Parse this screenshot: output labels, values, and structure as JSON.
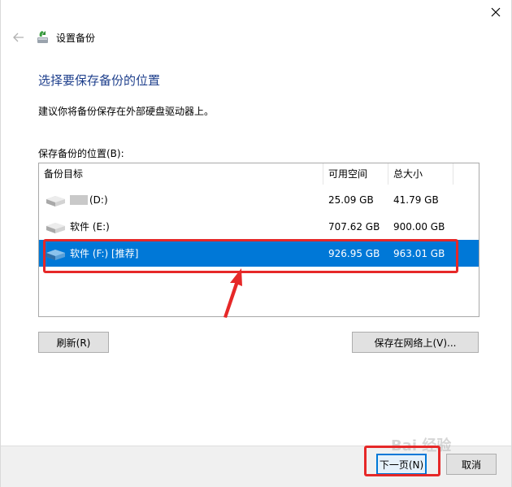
{
  "window": {
    "title": "设置备份"
  },
  "page": {
    "heading": "选择要保存备份的位置",
    "hint": "建议你将备份保存在外部硬盘驱动器上。",
    "list_label": "保存备份的位置(B):"
  },
  "table": {
    "columns": [
      "备份目标",
      "可用空间",
      "总大小"
    ],
    "rows": [
      {
        "name": "(D:)",
        "free": "25.09 GB",
        "total": "41.79 GB",
        "selected": false,
        "label_hidden": true
      },
      {
        "name": "软件 (E:)",
        "free": "707.62 GB",
        "total": "900.00 GB",
        "selected": false,
        "label_hidden": false
      },
      {
        "name": "软件 (F:) [推荐]",
        "free": "926.95 GB",
        "total": "963.01 GB",
        "selected": true,
        "label_hidden": false
      }
    ]
  },
  "buttons": {
    "refresh": "刷新(R)",
    "network": "保存在网络上(V)...",
    "next": "下一页(N)",
    "cancel": "取消"
  },
  "watermark": "Bai 经验",
  "colors": {
    "heading": "#1e3f8c",
    "selection": "#0078d7",
    "annotation": "#e62828"
  },
  "icons": {
    "close": "close-icon",
    "back": "back-arrow-icon",
    "app": "backup-icon",
    "drive": "drive-icon"
  }
}
